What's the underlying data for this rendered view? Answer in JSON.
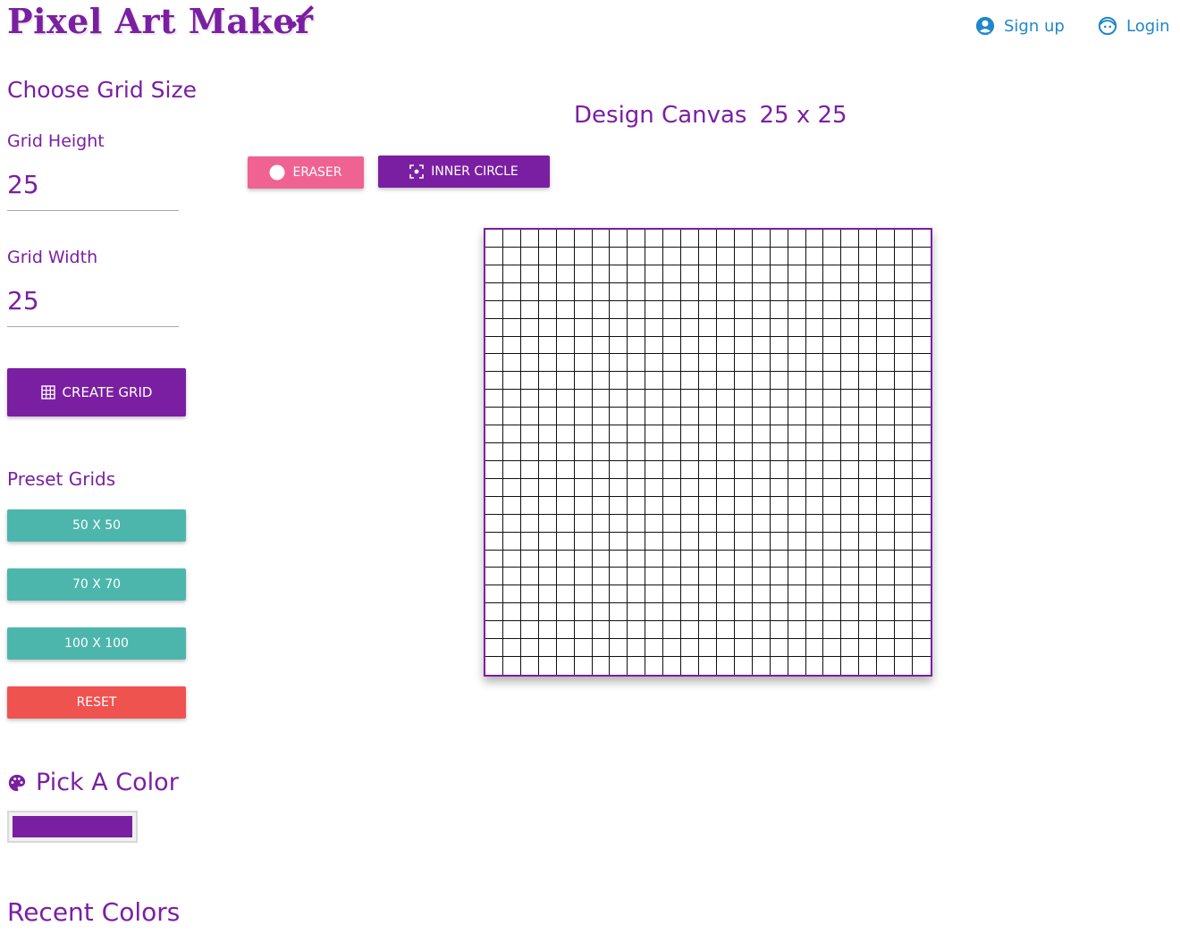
{
  "header": {
    "title": "Pixel Art Maker",
    "signup_label": "Sign up",
    "login_label": "Login",
    "link_color": "#1e88c9"
  },
  "sidebar": {
    "choose_grid_title": "Choose Grid Size",
    "grid_height_label": "Grid Height",
    "grid_height_value": "25",
    "grid_width_label": "Grid Width",
    "grid_width_value": "25",
    "create_grid_label": "CREATE GRID",
    "preset_title": "Preset Grids",
    "presets": [
      "50 X 50",
      "70 X 70",
      "100 X 100"
    ],
    "reset_label": "RESET",
    "pick_color_title": "Pick A Color",
    "picked_color": "#7b1fa2",
    "recent_colors_title": "Recent Colors"
  },
  "canvas": {
    "heading": "Design Canvas",
    "size_text": "25 x 25",
    "rows": 25,
    "cols": 25
  },
  "tools": {
    "eraser_label": "ERASER",
    "inner_circle_label": "INNER CIRCLE"
  },
  "colors": {
    "primary": "#7b1fa2",
    "preset_teal": "#4db6ac",
    "reset_red": "#ef5350",
    "eraser_pink": "#f06292"
  },
  "icons": {
    "brush": "brush-icon",
    "signup": "account-circle-icon",
    "login": "face-icon",
    "create_grid": "grid-icon",
    "eraser": "circle-icon",
    "inner_circle": "center-focus-icon",
    "palette": "palette-icon"
  }
}
